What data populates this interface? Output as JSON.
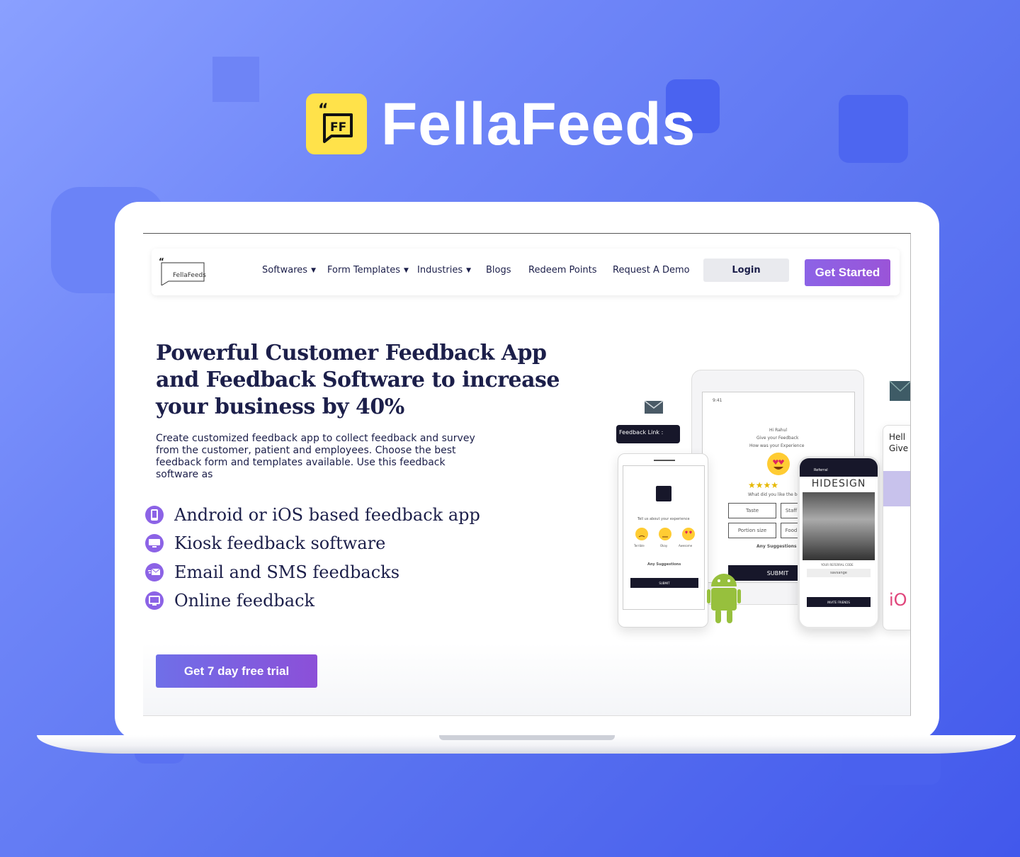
{
  "brand": {
    "name": "FellaFeeds",
    "logo_text": "FF"
  },
  "nav": {
    "logo_text": "FellaFeeds",
    "items": [
      {
        "label": "Softwares",
        "dropdown": true
      },
      {
        "label": "Form Templates",
        "dropdown": true
      },
      {
        "label": "Industries",
        "dropdown": true
      },
      {
        "label": "Blogs",
        "dropdown": false
      },
      {
        "label": "Redeem Points",
        "dropdown": false
      },
      {
        "label": "Request A Demo",
        "dropdown": false
      }
    ],
    "login": "Login",
    "get_started": "Get Started"
  },
  "hero": {
    "title": "Powerful Customer Feedback App and Feedback Software to increase your business by 40%",
    "description": "Create customized feedback app to collect feedback and survey from the customer, patient and employees. Choose the best feedback form and templates available. Use this feedback software as",
    "features": [
      {
        "label": "Android or iOS based feedback app",
        "icon": "phone-icon"
      },
      {
        "label": "Kiosk feedback software",
        "icon": "kiosk-icon"
      },
      {
        "label": "Email and SMS feedbacks",
        "icon": "email-icon"
      },
      {
        "label": "Online feedback",
        "icon": "monitor-icon"
      }
    ],
    "cta": "Get 7 day free trial"
  },
  "illustration": {
    "feedback_link": "Feedback Link :",
    "tablet": {
      "time": "9:41",
      "greeting": "Hi Rahul",
      "prompt1": "Give your Feedback",
      "prompt2": "How was your Experience",
      "question": "What did you like the best",
      "options": [
        "Taste",
        "Staff",
        "Portion size",
        "Food"
      ],
      "suggestions": "Any Suggestions",
      "submit": "SUBMIT"
    },
    "phone_left": {
      "prompt": "Tell us about your experience",
      "faces": [
        "Terrible",
        "Okay",
        "Awesome"
      ],
      "suggestions": "Any Suggestions",
      "submit": "SUBMIT"
    },
    "phone_right": {
      "header": "Referral",
      "store": "HIDESIGN",
      "code_label": "YOUR REFERRAL CODE",
      "code": "savsange",
      "button": "INVITE FRIENDS"
    },
    "side_card": {
      "line1": "Hell",
      "line2": "Give",
      "logo": "iO"
    }
  }
}
